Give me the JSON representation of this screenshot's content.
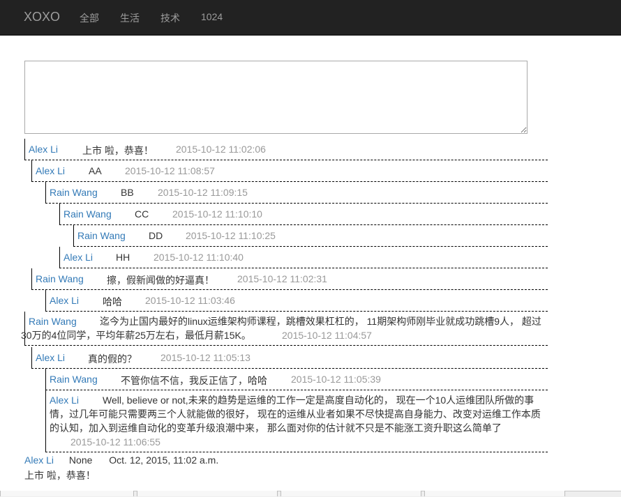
{
  "navbar": {
    "brand": "XOXO",
    "links": [
      "全部",
      "生活",
      "技术",
      "1024"
    ]
  },
  "comment_input": {
    "value": ""
  },
  "comments": [
    {
      "user": "Alex Li",
      "content": "上市 啦，恭喜！",
      "time": "2015-10-12 11:02:06"
    },
    {
      "user": "Alex Li",
      "content": "AA",
      "time": "2015-10-12 11:08:57"
    },
    {
      "user": "Rain Wang",
      "content": "BB",
      "time": "2015-10-12 11:09:15"
    },
    {
      "user": "Rain Wang",
      "content": "CC",
      "time": "2015-10-12 11:10:10"
    },
    {
      "user": "Rain Wang",
      "content": "DD",
      "time": "2015-10-12 11:10:25"
    },
    {
      "user": "Alex Li",
      "content": "HH",
      "time": "2015-10-12 11:10:40"
    },
    {
      "user": "Rain Wang",
      "content": "擦，假新闻做的好逼真！",
      "time": "2015-10-12 11:02:31"
    },
    {
      "user": "Alex Li",
      "content": "哈哈",
      "time": "2015-10-12 11:03:46"
    },
    {
      "user": "Rain Wang",
      "content_line1": "迄今为止国内最好的linux运维架构师课程，跳槽效果杠杠的，  11期架构师刚毕业就成功跳槽9人，  超过",
      "content_line2": "30万的4位同学，平均年薪25万左右，最低月薪15K。",
      "time": "2015-10-12 11:04:57"
    },
    {
      "user": "Alex Li",
      "content": "真的假的？",
      "time": "2015-10-12 11:05:13"
    },
    {
      "user": "Rain Wang",
      "content": "不管你信不信，我反正信了，哈哈",
      "time": "2015-10-12 11:05:39"
    },
    {
      "user": "Alex Li",
      "content_line1": "Well, believe or not,未来的趋势是运维的工作一定是高度自动化的，  现在一个10人运维团队所做的事",
      "content_line2": "情，过几年可能只需要两三个人就能做的很好，  现在的运维从业者如果不尽快提高自身能力、改变对运维工作本质",
      "content_line3": "的认知，加入到运维自动化的变革升级浪潮中来，  那么面对你的估计就不只是不能涨工资升职这么简单了",
      "time": "2015-10-12 11:06:55"
    }
  ],
  "post": {
    "author": "Alex Li",
    "field": "None",
    "date": "Oct. 12, 2015, 11:02 a.m.",
    "body": "上市 啦，恭喜！"
  }
}
